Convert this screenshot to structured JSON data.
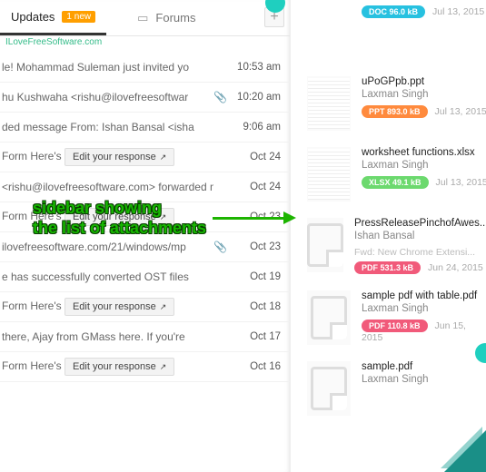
{
  "tabs": {
    "updates": {
      "label": "Updates",
      "badge": "1 new",
      "sub": "ILoveFreeSoftware.com"
    },
    "forums": {
      "label": "Forums"
    },
    "plus": "+"
  },
  "rows": [
    {
      "text": "le! Mohammad Suleman just invited yo",
      "date": "10:53 am",
      "clip": false,
      "btn": null
    },
    {
      "text": "hu Kushwaha <rishu@ilovefreesoftwar",
      "date": "10:20 am",
      "clip": true,
      "btn": null
    },
    {
      "text": "ded message From: Ishan Bansal <isha",
      "date": "9:06 am",
      "clip": false,
      "btn": null
    },
    {
      "text": "Form Here's",
      "date": "Oct 24",
      "clip": false,
      "btn": "Edit your response"
    },
    {
      "text": "<rishu@ilovefreesoftware.com> forwarded m",
      "date": "Oct 24",
      "clip": false,
      "btn": null
    },
    {
      "text": "Form Here's",
      "date": "Oct 23",
      "clip": false,
      "btn": "Edit your response"
    },
    {
      "text": "ilovefreesoftware.com/21/windows/mp",
      "date": "Oct 23",
      "clip": true,
      "btn": null
    },
    {
      "text": "e has successfully converted OST files",
      "date": "Oct 19",
      "clip": false,
      "btn": null
    },
    {
      "text": "Form Here's",
      "date": "Oct 18",
      "clip": false,
      "btn": "Edit your response"
    },
    {
      "text": "there, Ajay from GMass here. If you're",
      "date": "Oct 17",
      "clip": false,
      "btn": null
    },
    {
      "text": "Form Here's",
      "date": "Oct 16",
      "clip": false,
      "btn": "Edit your response"
    }
  ],
  "btn_label": "Edit your response",
  "attachments": [
    {
      "thumb": "blank",
      "name": "",
      "author": "",
      "pill": "DOC",
      "pillClass": "p-doc",
      "size": "96.0 kB",
      "date": "Jul 13, 2015"
    },
    {
      "thumb": "stripes",
      "name": "uPoGPpb.ppt",
      "author": "Laxman Singh",
      "pill": "PPT",
      "pillClass": "p-ppt",
      "size": "893.0 kB",
      "date": "Jul 13, 2015"
    },
    {
      "thumb": "stripes",
      "name": "worksheet functions.xlsx",
      "author": "Laxman Singh",
      "pill": "XLSX",
      "pillClass": "p-xlsx",
      "size": "49.1 kB",
      "date": "Jul 13, 2015"
    },
    {
      "thumb": "doc",
      "name": "PressReleasePinchofAwes...",
      "author": "Ishan Bansal",
      "extra": "Fwd: New Chrome Extensi...",
      "pill": "PDF",
      "pillClass": "p-pdf",
      "size": "531.3 kB",
      "date": "Jun 24, 2015"
    },
    {
      "thumb": "doc",
      "name": "sample pdf with table.pdf",
      "author": "Laxman Singh",
      "pill": "PDF",
      "pillClass": "p-pdf",
      "size": "110.8 kB",
      "date": "Jun 15, 2015"
    },
    {
      "thumb": "doc",
      "name": "sample.pdf",
      "author": "Laxman Singh",
      "pill": "",
      "pillClass": "",
      "size": "",
      "date": ""
    }
  ],
  "annotation": {
    "l1": "sidebar showing",
    "l2": "the list of attachments"
  },
  "clip_glyph": "📎"
}
